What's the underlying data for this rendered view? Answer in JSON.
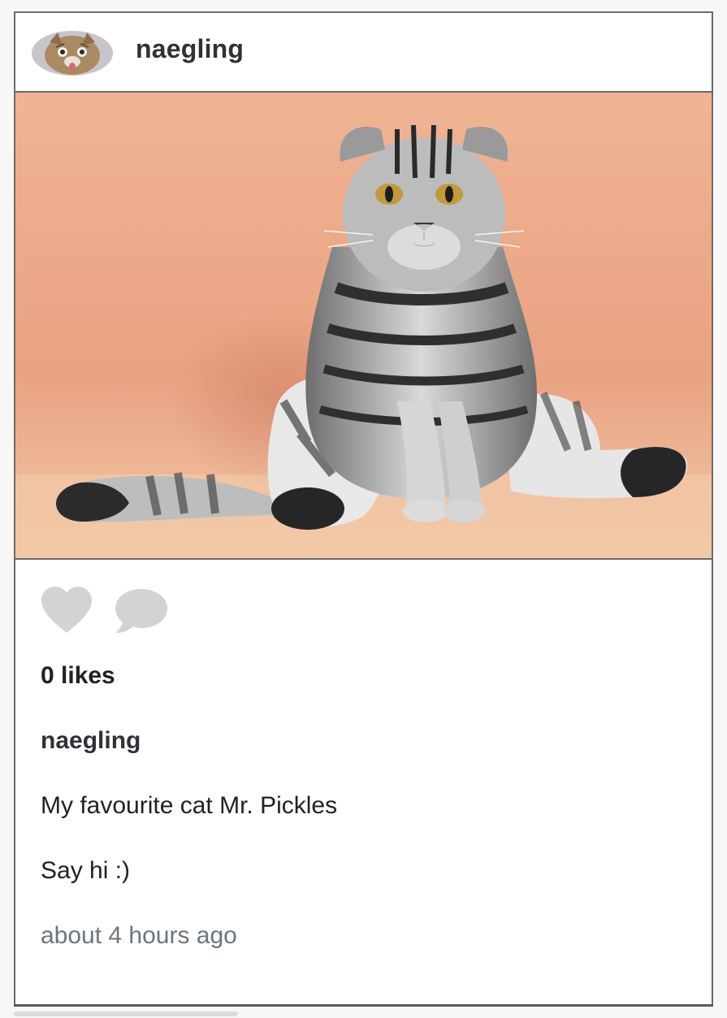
{
  "post": {
    "username": "naegling",
    "avatar_icon": "cat-avatar",
    "photo_description_icon": "cat-photo",
    "actions": {
      "like_icon": "heart-icon",
      "comment_icon": "comment-bubble-icon",
      "icon_color": "#d3d3d3"
    },
    "likes_text": "0 likes",
    "caption": {
      "username": "naegling",
      "lines": [
        "My favourite cat Mr. Pickles",
        "Say hi :)"
      ]
    },
    "timestamp": "about 4 hours ago"
  },
  "colors": {
    "border": "#6b6b6b",
    "photo_background": "#e8a585",
    "timestamp": "#6c757d"
  }
}
